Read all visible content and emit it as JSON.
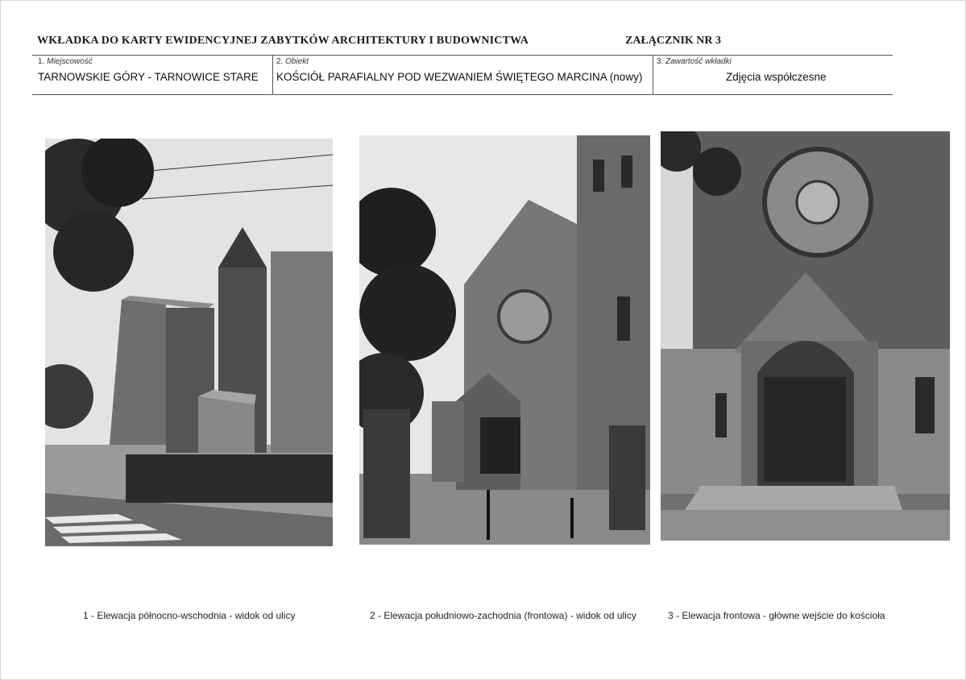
{
  "header": {
    "title": "WKŁADKA DO KARTY EWIDENCYJNEJ ZABYTKÓW ARCHITEKTURY I BUDOWNICTWA",
    "attachment": "ZAŁĄCZNIK NR 3"
  },
  "fields": [
    {
      "number": "1.",
      "label": "Miejscowość",
      "value": "TARNOWSKIE GÓRY - TARNOWICE STARE"
    },
    {
      "number": "2.",
      "label": "Obiekt",
      "value": "KOŚCIÓŁ PARAFIALNY POD WEZWANIEM ŚWIĘTEGO MARCINA (nowy)"
    },
    {
      "number": "3.",
      "label": "Zawartość wkładki",
      "value": "Zdjęcia współczesne"
    }
  ],
  "photos": [
    {
      "caption": "1 -  Elewacja północno-wschodnia  -  widok od ulicy"
    },
    {
      "caption": "2 -  Elewacja południowo-zachodnia (frontowa)  -  widok od ulicy"
    },
    {
      "caption": "3 -  Elewacja frontowa  -  główne wejście do kościoła"
    }
  ]
}
